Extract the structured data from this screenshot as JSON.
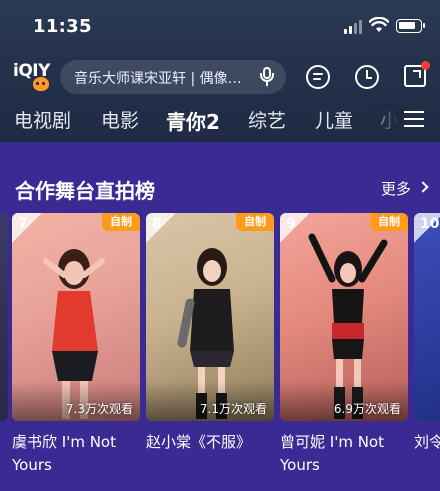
{
  "status": {
    "time": "11:35"
  },
  "search": {
    "placeholder": "音乐大师课宋亚轩 | 偶像练习生"
  },
  "nav": {
    "tabs": [
      {
        "label": "电视剧"
      },
      {
        "label": "电影"
      },
      {
        "label": "青你2",
        "active": true
      },
      {
        "label": "综艺"
      },
      {
        "label": "儿童"
      },
      {
        "label": "小"
      }
    ]
  },
  "section": {
    "title": "合作舞台直拍榜",
    "more_label": "更多"
  },
  "cards": [
    {
      "rank": "7",
      "tag": "自制",
      "views": "7.3万次观看",
      "title": "虞书欣 I'm Not Yours"
    },
    {
      "rank": "8",
      "tag": "自制",
      "views": "7.1万次观看",
      "title": "赵小棠《不服》"
    },
    {
      "rank": "9",
      "tag": "自制",
      "views": "6.9万次观看",
      "title": "曾可妮 I'm Not Yours"
    },
    {
      "rank": "10",
      "title": "刘令"
    }
  ],
  "colors": {
    "background": "#3a2a93",
    "header": "#223049",
    "tag": "#ff9b1a",
    "badge_dot": "#ff3b30"
  },
  "icons": [
    "signal-icon",
    "wifi-icon",
    "battery-icon",
    "iqiyi-logo",
    "microphone-icon",
    "message-icon",
    "history-clock-icon",
    "upload-icon",
    "menu-icon",
    "chevron-right-icon"
  ]
}
